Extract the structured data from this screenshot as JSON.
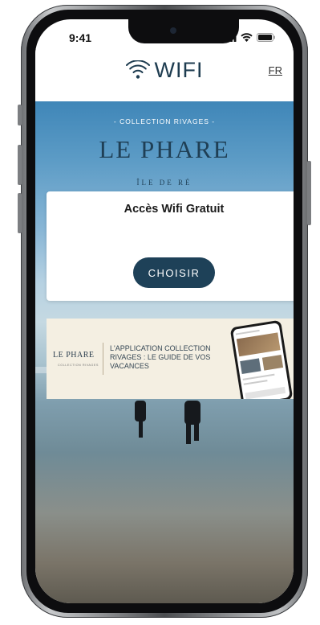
{
  "status_bar": {
    "time": "9:41"
  },
  "header": {
    "title": "WIFI",
    "language": "FR"
  },
  "hero": {
    "collection": "- COLLECTION RIVAGES -",
    "brand": "LE PHARE",
    "location": "ÎLE DE RÉ"
  },
  "card": {
    "title": "Accès Wifi Gratuit",
    "button_label": "CHOISIR"
  },
  "banner": {
    "logo": "LE PHARE",
    "logo_sub": "COLLECTION RIVAGES",
    "text": "L'APPLICATION COLLECTION RIVAGES : LE GUIDE DE VOS VACANCES"
  },
  "colors": {
    "primary": "#1e4158",
    "heading": "#1f3f55",
    "banner_bg": "#f4efe2"
  }
}
